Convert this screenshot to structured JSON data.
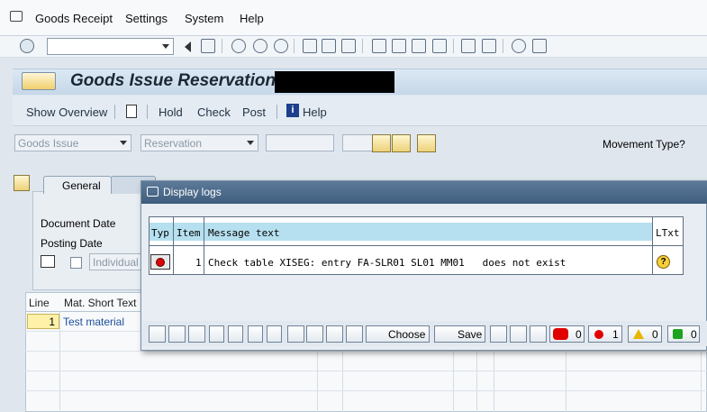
{
  "menu": [
    "Goods Receipt",
    "Settings",
    "System",
    "Help"
  ],
  "window": {
    "title": "Goods Issue Reservation -",
    "app_toolbar": [
      "Show Overview",
      "Hold",
      "Check",
      "Post",
      "Help"
    ]
  },
  "header": {
    "movement_dropdown": "Goods Issue",
    "reference_dropdown": "Reservation",
    "movement_type_label": "Movement Type?"
  },
  "tabs": [
    "General"
  ],
  "general": {
    "document_date_label": "Document Date",
    "posting_date_label": "Posting Date",
    "individual_label": "Individual"
  },
  "items_table": {
    "columns": [
      "Line",
      "Mat. Short Text"
    ],
    "rows": [
      {
        "line": "1",
        "text": "Test material"
      }
    ]
  },
  "dialog": {
    "title": "Display logs",
    "columns": [
      "Typ",
      "Item",
      "Message text",
      "LTxt"
    ],
    "rows": [
      {
        "type_icon": "red-light-icon",
        "item": "1",
        "message": "Check table XISEG: entry FA-SLR01 SL01 MM01   does not exist",
        "ltxt_icon": "question-icon"
      }
    ],
    "buttons": {
      "choose": "Choose",
      "save": "Save"
    },
    "counters": {
      "stop": "0",
      "error": "1",
      "warning": "0",
      "success": "0"
    }
  },
  "colors": {
    "title_bar": "#c6d7e8",
    "dialog_title": "#4b6a8b",
    "header_cell": "#b6e0f0",
    "line_cell": "#fff2a8"
  }
}
